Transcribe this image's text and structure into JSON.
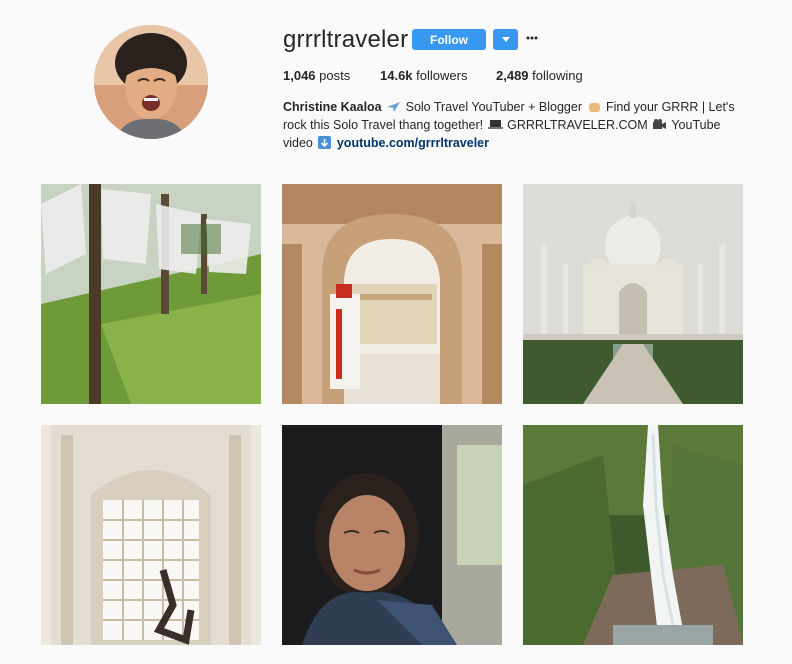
{
  "profile": {
    "username": "grrrltraveler",
    "follow_label": "Follow",
    "avatar_icon": "avatar-photo",
    "dropdown_icon": "chevron-down-icon",
    "more_icon": "more-icon"
  },
  "stats": {
    "posts_count": "1,046",
    "posts_label": "posts",
    "followers_count": "14.6k",
    "followers_label": "followers",
    "following_count": "2,489",
    "following_label": "following"
  },
  "bio": {
    "name": "Christine Kaaloa",
    "line1_text": "Solo Travel YouTuber + Blogger",
    "line1_tail": "Find your GRRR | Let's",
    "line2_head": "rock this Solo Travel thang together!",
    "line2_mid": "GRRRLTRAVELER.COM",
    "line2_tail": "YouTube",
    "line3_head": "video",
    "link": "youtube.com/grrrltraveler",
    "emoji_icons": [
      "airplane-icon",
      "fist-icon",
      "laptop-icon",
      "video-camera-icon",
      "down-arrow-icon"
    ]
  },
  "posts": [
    {
      "name": "prayer-flags-forest-photo"
    },
    {
      "name": "palace-archway-photo"
    },
    {
      "name": "taj-mahal-photo"
    },
    {
      "name": "marble-lattice-yoga-photo"
    },
    {
      "name": "selfie-vehicle-photo"
    },
    {
      "name": "waterfall-photo"
    }
  ],
  "colors": {
    "follow_blue": "#3897f0",
    "background": "#fafafa",
    "text": "#262626",
    "link": "#003569"
  }
}
